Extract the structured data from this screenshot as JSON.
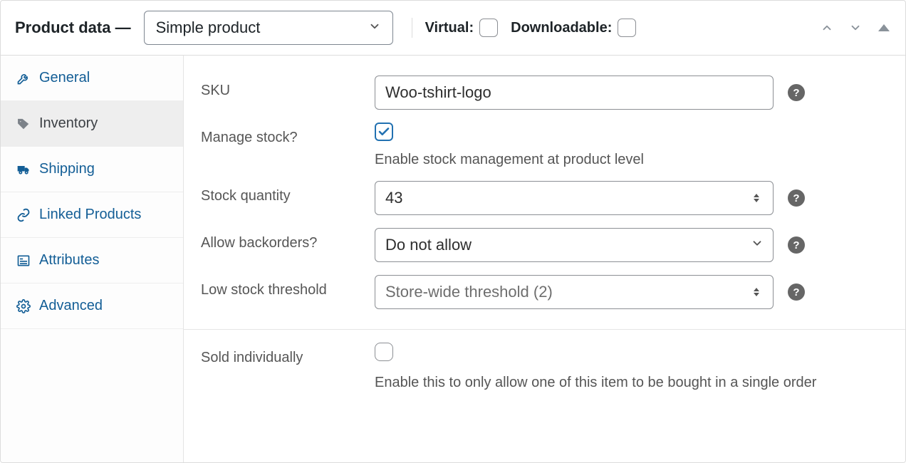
{
  "header": {
    "title": "Product data —",
    "product_type": "Simple product",
    "virtual_label": "Virtual:",
    "downloadable_label": "Downloadable:"
  },
  "sidebar": {
    "items": [
      {
        "label": "General"
      },
      {
        "label": "Inventory"
      },
      {
        "label": "Shipping"
      },
      {
        "label": "Linked Products"
      },
      {
        "label": "Attributes"
      },
      {
        "label": "Advanced"
      }
    ]
  },
  "fields": {
    "sku": {
      "label": "SKU",
      "value": "Woo-tshirt-logo"
    },
    "manage_stock": {
      "label": "Manage stock?",
      "desc": "Enable stock management at product level"
    },
    "stock_quantity": {
      "label": "Stock quantity",
      "value": "43"
    },
    "backorders": {
      "label": "Allow backorders?",
      "value": "Do not allow"
    },
    "low_stock": {
      "label": "Low stock threshold",
      "placeholder": "Store-wide threshold (2)"
    },
    "sold_individually": {
      "label": "Sold individually",
      "desc": "Enable this to only allow one of this item to be bought in a single order"
    }
  },
  "help_glyph": "?"
}
